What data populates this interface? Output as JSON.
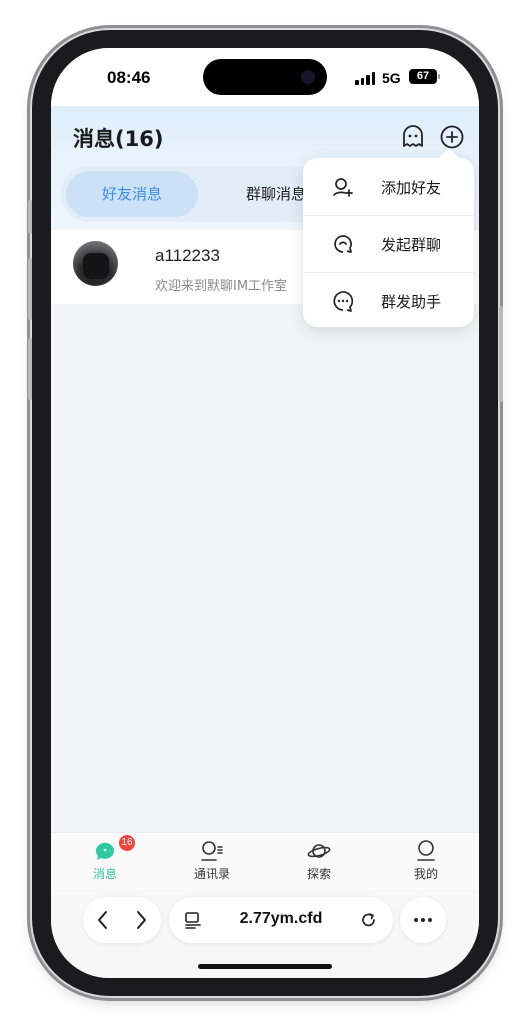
{
  "status_bar": {
    "time": "08:46",
    "network": "5G",
    "battery": "67"
  },
  "header": {
    "title": "消息(16)",
    "icons": [
      "ghost-icon",
      "add-circle-icon"
    ]
  },
  "tabs": [
    {
      "label": "好友消息",
      "active": true
    },
    {
      "label": "群聊消息",
      "active": false
    }
  ],
  "chats": [
    {
      "name": "a112233",
      "preview": "欢迎来到默聊IM工作室"
    }
  ],
  "menu": {
    "items": [
      {
        "label": "添加好友",
        "icon": "add-friend-icon"
      },
      {
        "label": "发起群聊",
        "icon": "group-chat-icon"
      },
      {
        "label": "群发助手",
        "icon": "broadcast-icon"
      }
    ]
  },
  "tabbar": {
    "items": [
      {
        "label": "消息",
        "icon": "message-icon",
        "badge": "16",
        "active": true
      },
      {
        "label": "通讯录",
        "icon": "contacts-icon",
        "active": false
      },
      {
        "label": "探索",
        "icon": "planet-icon",
        "active": false
      },
      {
        "label": "我的",
        "icon": "profile-icon",
        "active": false
      }
    ]
  },
  "browser": {
    "url": "2.77ym.cfd"
  },
  "colors": {
    "accent": "#3d8ee8",
    "tab_active": "#2fc9a0",
    "badge": "#f2453d"
  }
}
